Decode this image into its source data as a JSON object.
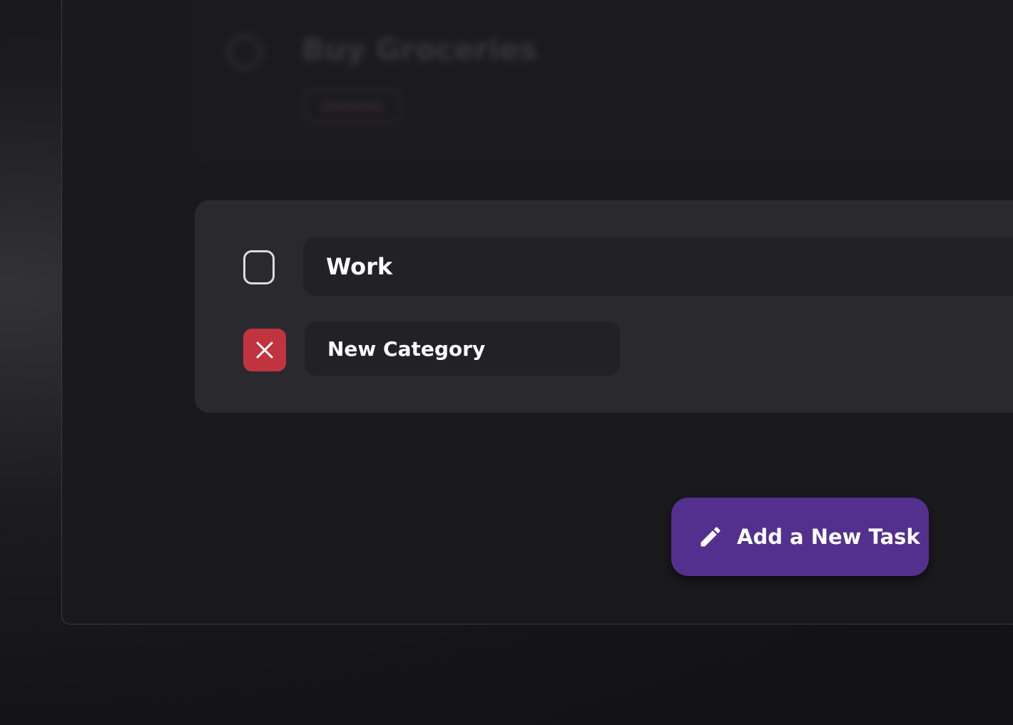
{
  "background_task": {
    "title": "Buy Groceries",
    "category_chip": "Groceries"
  },
  "category_editor": {
    "items": [
      {
        "name": "Work",
        "checkbox_state": "unchecked",
        "checkbox_icon": "rounded-square-outline-icon"
      },
      {
        "name": "New Category",
        "action_icon": "close-icon"
      }
    ]
  },
  "add_task_button": {
    "label": "Add a New Task",
    "icon": "pencil-icon"
  },
  "colors": {
    "accent": "#53308d",
    "delete": "#c0343f",
    "panel": "#2a292e",
    "window": "#1a1a1d"
  }
}
